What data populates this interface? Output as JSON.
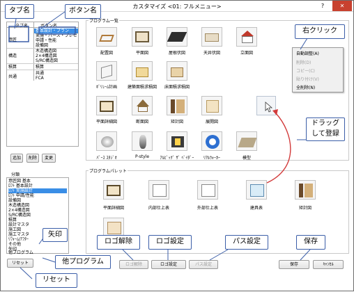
{
  "window": {
    "title": "カスタマイズ <01: フルメニュー>",
    "help": "?",
    "close": "✕"
  },
  "table": {
    "headers": [
      "タブ名",
      "ボタン名"
    ],
    "rows": [
      {
        "tab": "意匠",
        "buttons": [
          "基本設計・プラン",
          "実施・パース・プレゼ",
          "申請・性能",
          "設備図"
        ]
      },
      {
        "tab": "構造",
        "buttons": [
          "木造構造図",
          "2×4構造図",
          "S/RC構造図"
        ]
      },
      {
        "tab": "積算",
        "buttons": [
          "積算"
        ]
      },
      {
        "tab": "共通",
        "buttons": [
          "共通",
          "FCA"
        ]
      }
    ]
  },
  "table_buttons": [
    "追加",
    "削除",
    "変更"
  ],
  "list": {
    "label": "分類",
    "items": [
      "意匠図 基本",
      "ﾛﾌﾄ 基本設計",
      "ﾛﾌﾄ 実施設計",
      "ﾛﾌﾄ 申請/性能",
      "設備図",
      "木造構造図",
      "2×4構造図",
      "S/RC構造図",
      "積算",
      "設計マスタ",
      "施工図",
      "施工マスタ",
      "ﾘﾌｫｰﾑ/ｱﾌﾀｰ",
      "その他",
      "矢印",
      "他プログラム"
    ],
    "selected": 2
  },
  "program_list": {
    "label": "プログラム一覧",
    "rows": [
      [
        "配置図",
        "平面図",
        "屋根伏図",
        "天井伏図",
        "立面図"
      ],
      [
        "ﾎﾞﾘｭｰﾑ計画",
        "建築面積求積図",
        "床面積求積図"
      ],
      [
        "平面詳細図",
        "断面図",
        "矩計図",
        "展開図"
      ],
      [
        "ﾊﾟｰｽ ｽﾀｼﾞｵ",
        "P-style",
        "ｱﾙﾋﾞｯｸﾞ ｻﾞ ﾍﾞｲﾀﾞｰ",
        "ﾘｱﾙｳｫｰｶｰ",
        "模型"
      ]
    ]
  },
  "palette": {
    "label": "プログラムパレット",
    "items": [
      "平面詳細図",
      "内部仕上表",
      "外部仕上表",
      "建具表",
      "矩計図"
    ]
  },
  "context_menu": {
    "items": [
      {
        "label": "自動調整(A)",
        "enabled": true
      },
      {
        "label": "削除(D)",
        "enabled": false
      },
      {
        "label": "コピー(C)",
        "enabled": false
      },
      {
        "label": "貼り付け(V)",
        "enabled": false
      },
      {
        "label": "全削除(N)",
        "enabled": true
      }
    ]
  },
  "bottom_buttons": {
    "reset": "リセット",
    "logo_remove": "ロゴ解除",
    "logo_set": "ロゴ設定",
    "path_set": "パス設定",
    "save": "保存",
    "cancel": "ｷｬﾝｾﾙ"
  },
  "callouts": {
    "tab_name": "タブ名",
    "button_name": "ボタン名",
    "right_click": "右クリック",
    "drag": "ドラッグ\nして登録",
    "arrow": "矢印",
    "other_program": "他プログラム",
    "logo_remove": "ロゴ解除",
    "logo_set": "ロゴ設定",
    "path_set": "パス設定",
    "save": "保存",
    "reset": "リセット"
  },
  "colors": {
    "callout_border": "#3b5ea8",
    "arrow_red": "#d23a3a",
    "selection": "#3a8ee6"
  }
}
